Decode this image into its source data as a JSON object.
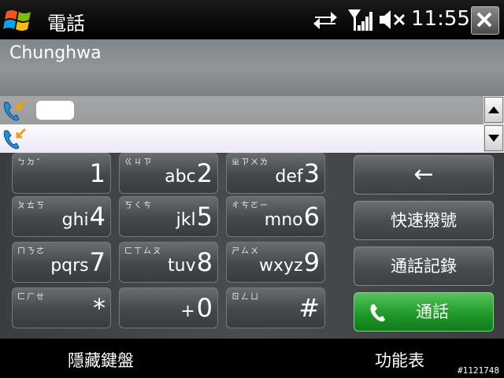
{
  "titlebar": {
    "title": "電話",
    "time": "11:55"
  },
  "carrier": "Chunghwa",
  "call_list": [
    {
      "icon": "incoming-call-icon"
    },
    {
      "icon": "incoming-call-icon"
    }
  ],
  "keypad": [
    {
      "sub": "ㄅㄉˇ",
      "letters": "",
      "digit": "1"
    },
    {
      "sub": "ㄍㄐㄗ",
      "letters": "abc",
      "digit": "2"
    },
    {
      "sub": "ㄓㄗㄨㄌ",
      "letters": "def",
      "digit": "3"
    },
    {
      "sub": "ㄆㄊㄎ",
      "letters": "ghi",
      "digit": "4"
    },
    {
      "sub": "ㄎㄑㄘ",
      "letters": "jkl",
      "digit": "5"
    },
    {
      "sub": "ㄔㄘㄛー",
      "letters": "mno",
      "digit": "6"
    },
    {
      "sub": "ㄇㄋㄜ",
      "letters": "pqrs",
      "digit": "7"
    },
    {
      "sub": "ㄈㄒㄙㄡ",
      "letters": "tuv",
      "digit": "8"
    },
    {
      "sub": "ㄕㄙㄨ",
      "letters": "wxyz",
      "digit": "9"
    },
    {
      "sub": "ㄈㄏㄝ",
      "letters": "",
      "digit": "*"
    },
    {
      "sub": "",
      "letters": "+",
      "digit": "0"
    },
    {
      "sub": "ㄖㄥㄩ",
      "letters": "",
      "digit": "#"
    }
  ],
  "actions": {
    "backspace": "←",
    "speed_dial": "快速撥號",
    "call_history": "通話記錄",
    "talk": "通話"
  },
  "softkeys": {
    "left": "隱藏鍵盤",
    "right": "功能表"
  },
  "watermark": "#1121748",
  "colors": {
    "call_button": "#1f9a2a",
    "selected_row": "#a3a5a7"
  }
}
